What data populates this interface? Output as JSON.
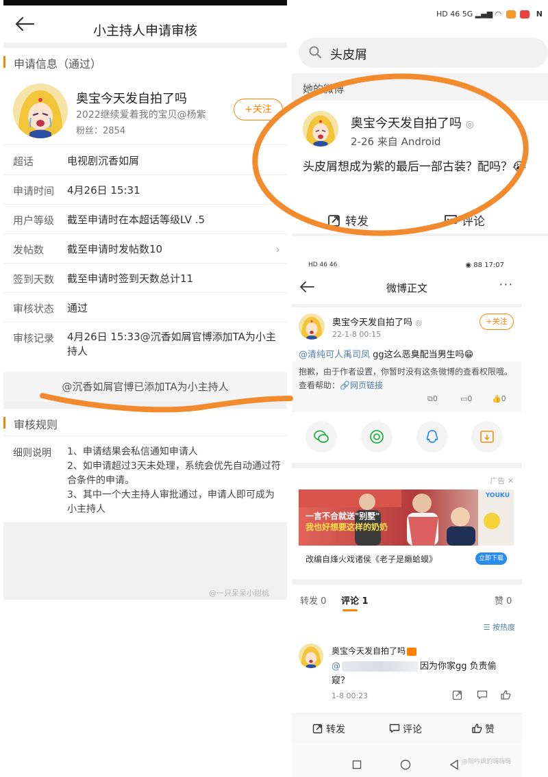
{
  "left": {
    "nav_title": "小主持人申请审核",
    "section_apply": "申请信息（通过）",
    "profile": {
      "name": "奥宝今天发自拍了吗",
      "subtitle": "2022继续爱着我的宝贝@杨紫",
      "fans": "粉丝：2854",
      "follow_label": "+关注"
    },
    "rows": [
      {
        "key": "超话",
        "value": "电视剧沉香如屑"
      },
      {
        "key": "申请时间",
        "value": "4月26日 15:31"
      },
      {
        "key": "用户等级",
        "value": "截至申请时在本超话等级LV .5"
      },
      {
        "key": "发帖数",
        "value": "截至申请时发帖数10"
      },
      {
        "key": "签到天数",
        "value": "截至申请时签到天数总计11"
      },
      {
        "key": "审核状态",
        "value": "通过"
      },
      {
        "key": "审核记录",
        "value": "4月26日 15:33@沉香如屑官博添加TA为小主持人"
      }
    ],
    "added_note": "@沉香如屑官博已添加TA为小主持人",
    "section_rules": "审核规则",
    "rules_key": "细则说明",
    "rules_lines": [
      "1、申请结果会私信通知申请人",
      "2、如申请超过3天未处理，系统会优先自动通过符合条件的申请。",
      "3、其中一个大主持人审批通过，申请人即可成为小主持人"
    ],
    "watermark": "@一只呆呆小甜桃"
  },
  "search": {
    "status_text": "HD 46 5G",
    "query": "头皮屑",
    "section_label": "她的微博",
    "post": {
      "name": "奥宝今天发自拍了吗",
      "meta": "2-26  来自 Android",
      "text": "头皮屑想成为紫的最后一部古装？配吗？😭",
      "repost_label": "转发",
      "comment_label": "评论"
    }
  },
  "detail": {
    "status_left": "HD 46 46",
    "status_right": "88 17:07",
    "nav_title": "微博正文",
    "more": "···",
    "author": "奥宝今天发自拍了吗",
    "time": "22-1-8 00:15",
    "follow_label": "+关注",
    "mention": "@清纯可人禹司凤",
    "line_text": " gg这么恶臭配当男生吗😁",
    "quote_text": "抱歉，由于作者设置，你暂时没有这条微博的查看权限哦。查看帮助：",
    "quote_link": "网页链接",
    "quote_counts": {
      "repost": "0",
      "comment": "0",
      "like": "0"
    },
    "ad_label": "广告",
    "ad_caption": "改编自烽火戏诸侯《老子是癞蛤蟆》",
    "ad_button": "立即下载",
    "ad_slogan_1": "一言不合就送\"别墅\"",
    "ad_slogan_2": "我也好想要这样的奶奶",
    "ad_brand": "YOUKU",
    "tabs": {
      "repost": "转发 0",
      "comment": "评论 1",
      "like": "赞 0"
    },
    "sort_label": "按热度",
    "comment": {
      "name": "奥宝今天发自拍了吗",
      "at": "@",
      "text_after": "因为你家gg 负责偷",
      "line2": "窥？",
      "time": "1-8 00:23"
    },
    "bottom": {
      "repost": "转发",
      "comment": "评论",
      "like": "赞"
    },
    "watermark": "@阳吟飒的嗨嗨嗨"
  }
}
